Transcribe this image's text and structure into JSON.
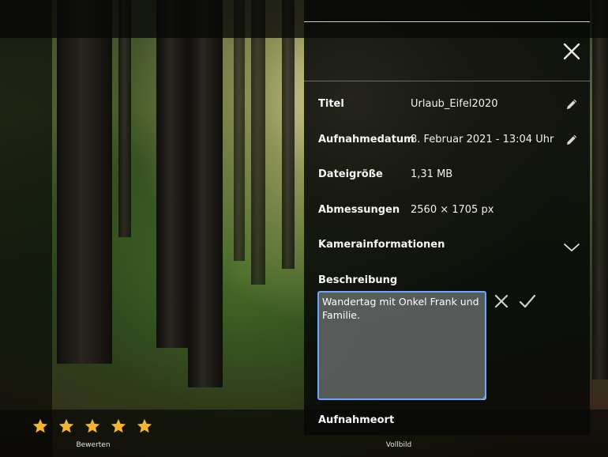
{
  "panel": {
    "details": [
      {
        "label": "Titel",
        "value": "Urlaub_Eifel2020",
        "editable": true
      },
      {
        "label": "Aufnahmedatum",
        "value": "8. Februar 2021 - 13:04 Uhr",
        "editable": true
      },
      {
        "label": "Dateigröße",
        "value": "1,31 MB",
        "editable": false
      },
      {
        "label": "Abmessungen",
        "value": "2560 × 1705 px",
        "editable": false
      }
    ],
    "camera_info_label": "Kamerainformationen",
    "description_label": "Beschreibung",
    "description_value": "Wandertag mit Onkel Frank und Familie.",
    "location_label": "Aufnahmeort"
  },
  "rating": {
    "stars_filled": 5,
    "stars_total": 5,
    "caption": "Bewerten",
    "star_color": "#f2b531"
  },
  "fullscreen_caption": "Vollbild",
  "icons": [
    "close-icon",
    "pencil-icon",
    "chevron-down-icon",
    "cancel-icon",
    "check-icon",
    "star-icon"
  ],
  "colors": {
    "accent_focus": "#6aa7ff"
  }
}
